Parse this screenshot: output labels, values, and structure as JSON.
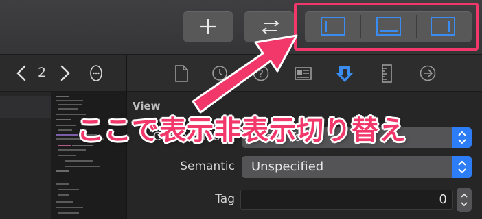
{
  "toolbar": {
    "add_icon": "plus-icon",
    "swap_icon": "swap-arrows-icon",
    "segments": [
      {
        "name": "navigator-panel-toggle",
        "icon": "left-panel-icon"
      },
      {
        "name": "debug-area-toggle",
        "icon": "bottom-panel-icon"
      },
      {
        "name": "utilities-panel-toggle",
        "icon": "right-panel-icon"
      }
    ],
    "accent_color": "#3b8cf0",
    "highlight_color": "#f2386a"
  },
  "editor_header": {
    "page_number": "2",
    "prev_icon": "chevron-left-icon",
    "next_icon": "chevron-right-icon",
    "more_icon": "more-options-icon"
  },
  "inspector": {
    "tabs": [
      {
        "name": "file-inspector-tab",
        "icon": "file-icon"
      },
      {
        "name": "history-inspector-tab",
        "icon": "clock-icon"
      },
      {
        "name": "quick-help-tab",
        "icon": "question-icon"
      },
      {
        "name": "identity-inspector-tab",
        "icon": "id-card-icon"
      },
      {
        "name": "attributes-inspector-tab",
        "icon": "attributes-arrow-icon",
        "active": true
      },
      {
        "name": "size-inspector-tab",
        "icon": "ruler-icon"
      },
      {
        "name": "connections-inspector-tab",
        "icon": "arrow-circle-icon"
      }
    ],
    "section_title": "View",
    "fields": {
      "content_mode": {
        "label": "Content Mode",
        "value": "Scale To Fill"
      },
      "semantic": {
        "label": "Semantic",
        "value": "Unspecified"
      },
      "tag": {
        "label": "Tag",
        "value": "0"
      }
    }
  },
  "annotation": {
    "text": "ここで表示非表示切り替え"
  }
}
